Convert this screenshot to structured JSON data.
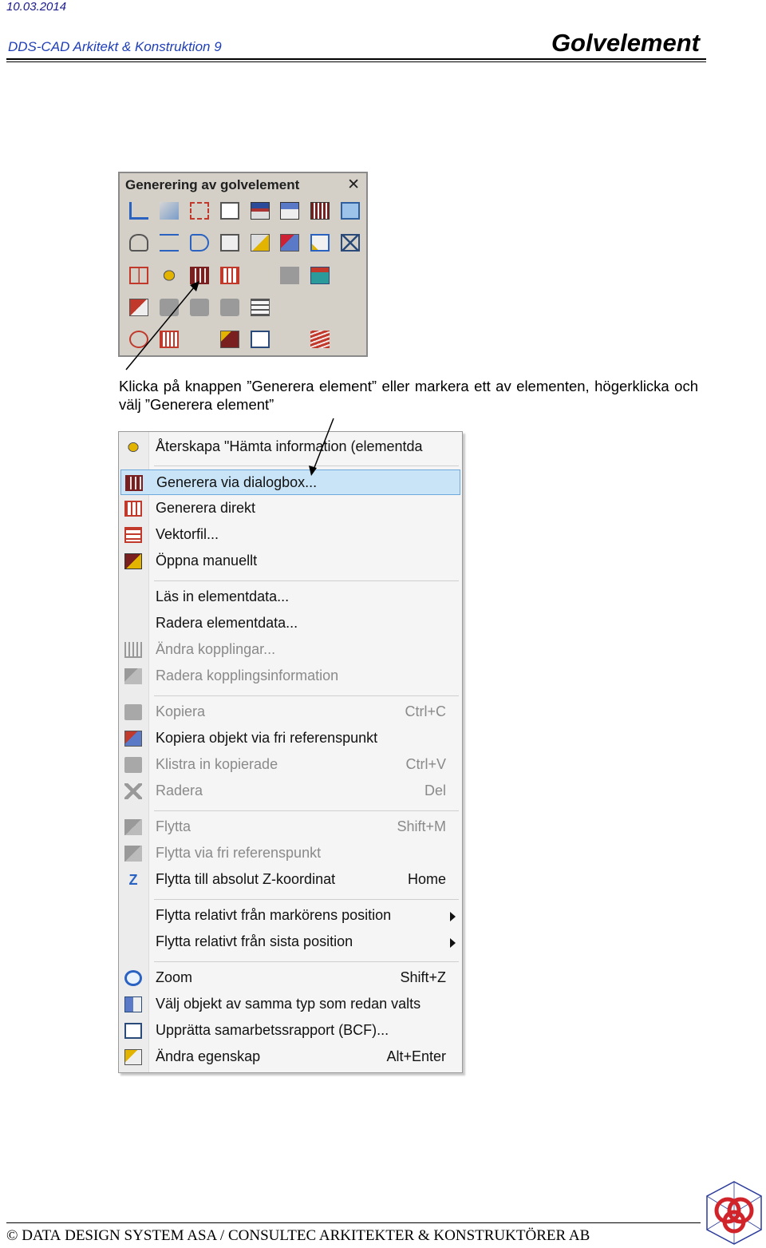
{
  "header": {
    "date": "10.03.2014",
    "doc_title": "DDS-CAD Arkitekt & Konstruktion 9",
    "page_heading": "Golvelement"
  },
  "toolbar": {
    "title": "Generering av golvelement",
    "close_glyph": "✕"
  },
  "instruction": "Klicka på knappen ”Generera element” eller markera ett av elementen, högerklicka och välj ”Generera element”",
  "menu": {
    "items": [
      {
        "label": "Återskapa \"Hämta information (elementda",
        "shortcut": "",
        "icon": "restore-icon"
      },
      {
        "label": "Generera via dialogbox...",
        "shortcut": "",
        "icon": "generate-dialog-icon"
      },
      {
        "label": "Generera direkt",
        "shortcut": "",
        "icon": "generate-direct-icon"
      },
      {
        "label": "Vektorfil...",
        "shortcut": "",
        "icon": "vector-file-icon"
      },
      {
        "label": "Öppna manuellt",
        "shortcut": "",
        "icon": "open-manual-icon"
      },
      {
        "label": "Läs in elementdata...",
        "shortcut": "",
        "icon": ""
      },
      {
        "label": "Radera elementdata...",
        "shortcut": "",
        "icon": ""
      },
      {
        "label": "Ändra kopplingar...",
        "shortcut": "",
        "icon": "connections-icon"
      },
      {
        "label": "Radera kopplingsinformation",
        "shortcut": "",
        "icon": "delete-connections-icon"
      },
      {
        "label": "Kopiera",
        "shortcut": "Ctrl+C",
        "icon": "copy-icon"
      },
      {
        "label": "Kopiera objekt via fri referenspunkt",
        "shortcut": "",
        "icon": "copy-ref-icon"
      },
      {
        "label": "Klistra in kopierade",
        "shortcut": "Ctrl+V",
        "icon": "paste-icon"
      },
      {
        "label": "Radera",
        "shortcut": "Del",
        "icon": "delete-icon"
      },
      {
        "label": "Flytta",
        "shortcut": "Shift+M",
        "icon": "move-icon"
      },
      {
        "label": "Flytta via fri referenspunkt",
        "shortcut": "",
        "icon": "move-ref-icon"
      },
      {
        "label": "Flytta till absolut Z-koordinat",
        "shortcut": "Home",
        "icon": "z-icon"
      },
      {
        "label": "Flytta relativt från markörens position",
        "shortcut": "",
        "icon": ""
      },
      {
        "label": "Flytta relativt från sista position",
        "shortcut": "",
        "icon": ""
      },
      {
        "label": "Zoom",
        "shortcut": "Shift+Z",
        "icon": "zoom-icon"
      },
      {
        "label": "Välj objekt av samma typ som redan valts",
        "shortcut": "",
        "icon": "select-same-icon"
      },
      {
        "label": "Upprätta samarbetssrapport (BCF)...",
        "shortcut": "",
        "icon": "bcf-icon"
      },
      {
        "label": "Ändra egenskap",
        "shortcut": "Alt+Enter",
        "icon": "properties-icon"
      }
    ]
  },
  "footer": {
    "copyright": "©",
    "d": "D",
    "ata": "ATA",
    "d2": "D",
    "esign": "ESIGN",
    "s": "S",
    "ystem": "YSTEM",
    "asa": " ASA / ",
    "c": "C",
    "onsultec": "ONSULTEC",
    "a": "A",
    "rkitekter": "RKITEKTER",
    "amp": " & ",
    "k": "K",
    "onstruktorer": "ONSTRUKTÖRER",
    "ab": " AB"
  }
}
